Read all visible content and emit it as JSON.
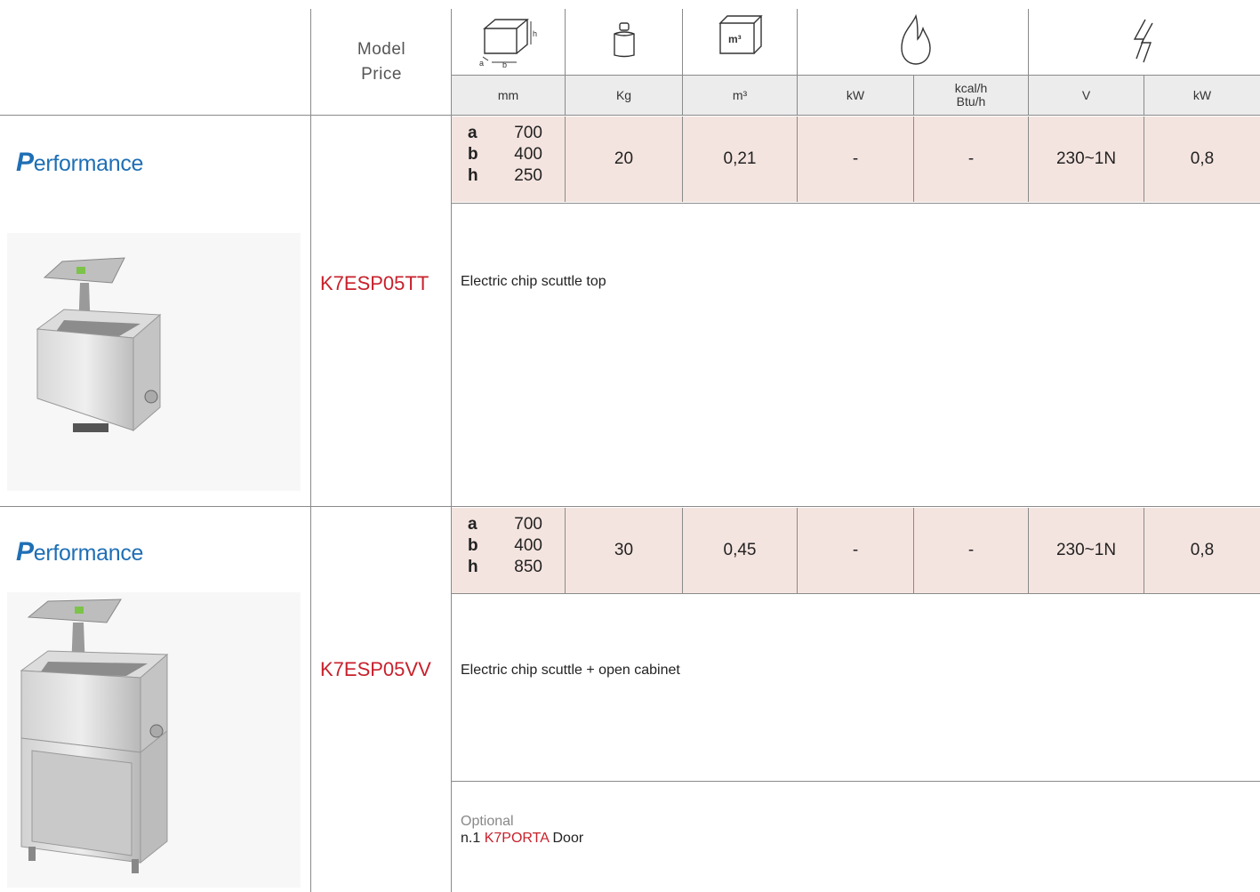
{
  "header": {
    "model_label": "Model",
    "price_label": "Price",
    "icons": [
      "dimensions-box-icon",
      "weight-icon",
      "volume-box-icon",
      "gas-flame-icon",
      "electric-icon"
    ],
    "dim_icon_labels": {
      "a": "a",
      "b": "b",
      "h": "h"
    },
    "volume_icon_label": "m³",
    "units": {
      "mm": "mm",
      "kg": "Kg",
      "m3": "m³",
      "gas_kw": "kW",
      "kcal_line1": "kcal/h",
      "kcal_line2": "Btu/h",
      "volt": "V",
      "elec_kw": "kW"
    }
  },
  "products": [
    {
      "series": {
        "initial": "P",
        "rest": "erformance"
      },
      "code": "K7ESP05TT",
      "description": "Electric chip scuttle top",
      "dims": {
        "a_label": "a",
        "a": "700",
        "b_label": "b",
        "b": "400",
        "h_label": "h",
        "h": "250"
      },
      "weight": "20",
      "volume": "0,21",
      "gas_kw": "-",
      "gas_kcal": "-",
      "voltage": "230~1N",
      "elec_kw": "0,8"
    },
    {
      "series": {
        "initial": "P",
        "rest": "erformance"
      },
      "code": "K7ESP05VV",
      "description": "Electric chip scuttle + open cabinet",
      "dims": {
        "a_label": "a",
        "a": "700",
        "b_label": "b",
        "b": "400",
        "h_label": "h",
        "h": "850"
      },
      "weight": "30",
      "volume": "0,45",
      "gas_kw": "-",
      "gas_kcal": "-",
      "voltage": "230~1N",
      "elec_kw": "0,8",
      "optional": {
        "title": "Optional",
        "prefix": "n.1",
        "code": "K7PORTA",
        "label": "Door"
      }
    }
  ],
  "colors": {
    "accent_red": "#c8202b",
    "brand_blue": "#1f6fb5",
    "spec_row_bg": "#f4e4df",
    "unit_row_bg": "#ececec"
  }
}
